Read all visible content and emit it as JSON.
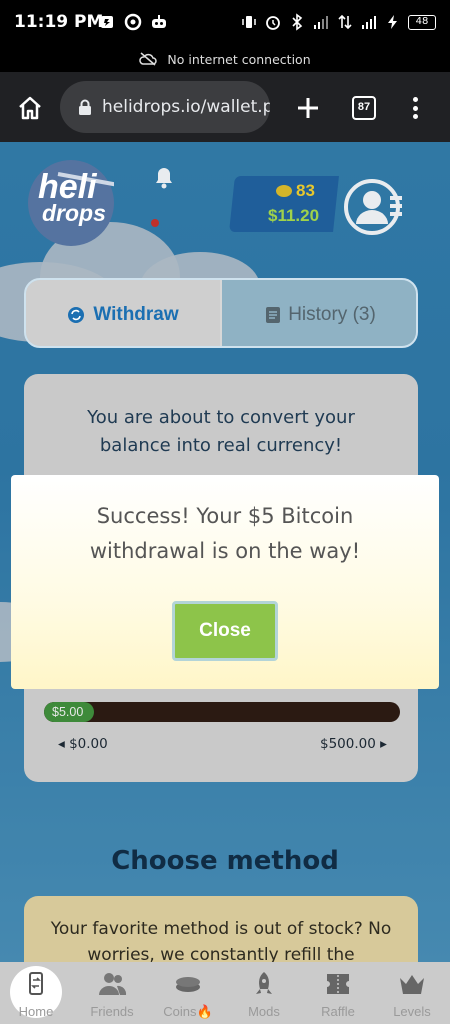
{
  "status_bar": {
    "time": "11:19 PM",
    "battery": "48"
  },
  "network_banner": {
    "text": "No internet connection"
  },
  "browser": {
    "url": "helidrops.io/wallet.pl",
    "tab_count": "87"
  },
  "header": {
    "logo": {
      "line1": "heli",
      "line2": "drops"
    },
    "coins": "83",
    "usd_balance": "$11.20"
  },
  "tabs": {
    "withdraw_label": "Withdraw",
    "history_label": "History (3)"
  },
  "convert_card": {
    "intro": "You are about to convert your balance into real currency!",
    "slider": {
      "value_label": "$5.00",
      "min_label": "$0.00",
      "max_label": "$500.00",
      "value_fraction": 0.14
    }
  },
  "choose_method": {
    "title": "Choose method",
    "info": "Your favorite method is out of stock? No worries, we constantly refill the"
  },
  "modal": {
    "message": "Success! Your $5 Bitcoin withdrawal is on the way!",
    "close_label": "Close"
  },
  "bottom_nav": {
    "items": [
      {
        "label": "Home"
      },
      {
        "label": "Friends"
      },
      {
        "label": "Coins"
      },
      {
        "label": "Mods"
      },
      {
        "label": "Raffle"
      },
      {
        "label": "Levels"
      }
    ]
  },
  "colors": {
    "accent_blue": "#1b6fb2",
    "coin_gold": "#e7c72e",
    "usd_green": "#9fd24b",
    "close_button": "#8dc44a"
  }
}
